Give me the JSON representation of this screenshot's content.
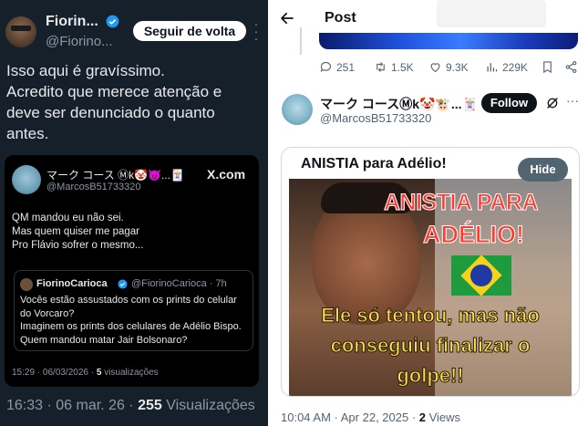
{
  "left": {
    "author": {
      "name": "Fiorin...",
      "handle": "@Fiorino...",
      "follow_label": "Seguir de volta"
    },
    "tweet_lines": [
      "Isso aqui é gravíssimo.",
      "Acredito que merece atenção e",
      "deve ser denunciado o quanto",
      "antes."
    ],
    "embed": {
      "name": "マーク コース Ⓜk🤡😈...🃏",
      "handle": "@MarcosB51733320",
      "source": "X.com",
      "lines": [
        "QM mandou eu não sei.",
        "Mas quem quiser me pagar",
        "Pro Flávio sofrer o mesmo..."
      ],
      "quote": {
        "name": "FiorinoCarioca",
        "handle": "@FiorinoCarioca · 7h",
        "lines": [
          "Vocês estão assustados com os prints do celular",
          "do Vorcaro?",
          "Imaginem os prints dos celulares de Adélio Bispo.",
          "Quem mandou matar Jair Bolsonaro?"
        ]
      },
      "meta_time": "15:29 · 06/03/2026 · ",
      "meta_views_count": "5",
      "meta_views_label": " visualizações"
    },
    "footer": {
      "time": "16:33 · 06 mar. 26 · ",
      "views_count": "255",
      "views_label": " Visualizações"
    }
  },
  "right": {
    "header_title": "Post",
    "prev_actions": {
      "replies": "251",
      "reposts": "1.5K",
      "likes": "9.3K",
      "views": "229K"
    },
    "author": {
      "name": "マーク コースⓂk🤡🐮...🃏",
      "handle": "@MarcosB51733320",
      "follow_label": "Follow"
    },
    "card": {
      "title": "ANISTIA para Adélio!",
      "hide_label": "Hide",
      "image_line1": "ANISTIA PARA",
      "image_line2": "ADÉLIO!",
      "caption_lines": [
        "Ele só tentou, mas não",
        "conseguiu finalizar o",
        "golpe!!"
      ]
    },
    "meta": {
      "time": "10:04 AM · Apr 22, 2025 · ",
      "views_count": "2",
      "views_label": " Views"
    }
  },
  "colors": {
    "left_bg": "#15202b",
    "right_bg": "#ffffff",
    "verified": "#1d9bf0",
    "headline_red": "#ff3a2e",
    "caption_yellow": "#f9e04a"
  },
  "icons": [
    "verified-icon",
    "more-icon",
    "back-arrow-icon",
    "reply-icon",
    "repost-icon",
    "like-icon",
    "views-icon",
    "bookmark-icon",
    "share-icon",
    "grok-icon"
  ]
}
